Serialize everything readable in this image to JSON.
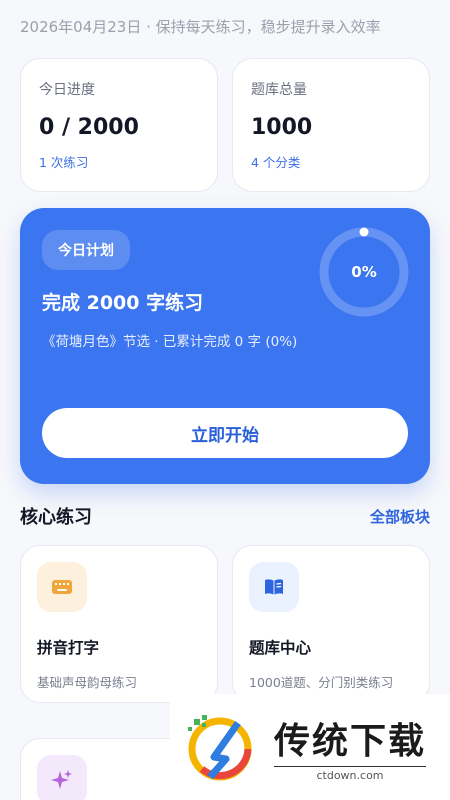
{
  "header": {
    "date_line": "2026年04月23日 · 保持每天练习，稳步提升录入效率"
  },
  "stats": [
    {
      "label": "今日进度",
      "value": "0 / 2000",
      "sub": "1 次练习"
    },
    {
      "label": "题库总量",
      "value": "1000",
      "sub": "4 个分类"
    }
  ],
  "plan": {
    "badge": "今日计划",
    "title": "完成 2000 字练习",
    "description": "《荷塘月色》节选 · 已累计完成 0 字 (0%)",
    "progress_text": "0%",
    "progress": 0,
    "start_label": "立即开始"
  },
  "section": {
    "title": "核心练习",
    "link": "全部板块"
  },
  "features": [
    {
      "title": "拼音打字",
      "desc": "基础声母韵母练习",
      "icon": "keyboard-icon",
      "icon_bg": "#fdf0dc",
      "icon_color": "#f0a63a"
    },
    {
      "title": "题库中心",
      "desc": "1000道题、分门别类练习",
      "icon": "book-icon",
      "icon_bg": "#eaf1ff",
      "icon_color": "#2f66e0"
    },
    {
      "title": "",
      "desc": "",
      "icon": "sparkle-icon",
      "icon_bg": "#f4e8fb",
      "icon_color": "#b764e0"
    }
  ],
  "watermark": {
    "brand": "传统下载",
    "domain": "ctdown.com"
  },
  "colors": {
    "accent": "#3b75f0",
    "link": "#2f66e0"
  }
}
